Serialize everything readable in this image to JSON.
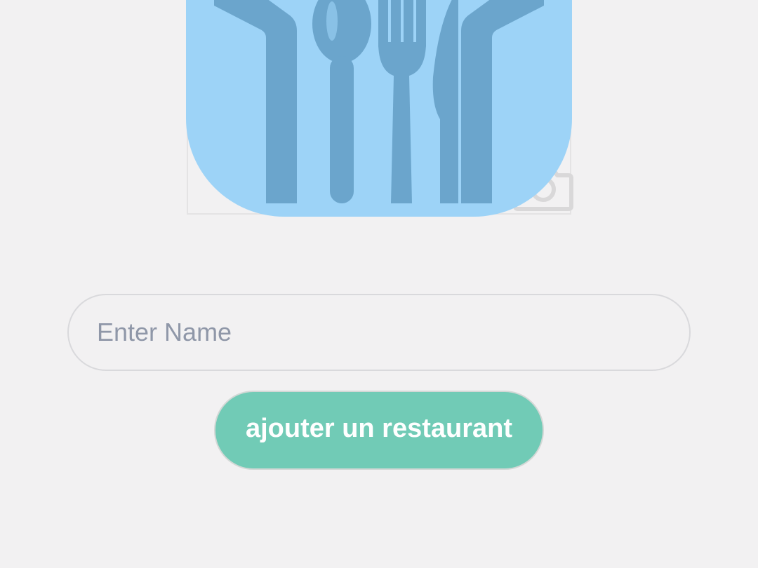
{
  "form": {
    "name_placeholder": "Enter Name",
    "name_value": "",
    "submit_label": "ajouter un restaurant"
  },
  "logo": {
    "icon": "cutlery-icon",
    "background_color": "#9dd3f7",
    "glyph_color": "#6ba5cc"
  },
  "image_picker": {
    "icon": "camera-icon"
  },
  "colors": {
    "background": "#f2f1f2",
    "button": "#71cbb6",
    "button_text": "#ffffff",
    "placeholder": "#8f97a8"
  }
}
